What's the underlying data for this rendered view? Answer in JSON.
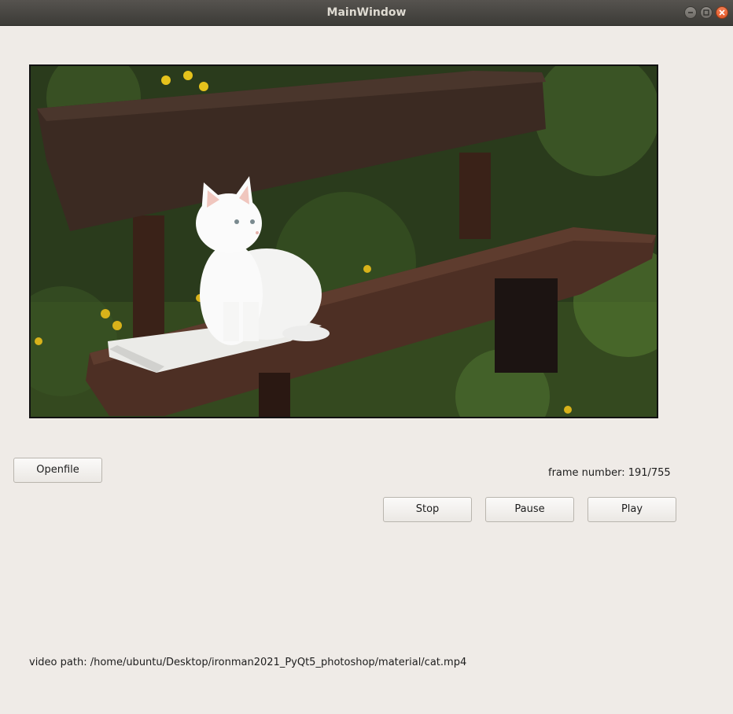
{
  "window": {
    "title": "MainWindow",
    "controls": {
      "minimize_icon": "minimize-icon",
      "maximize_icon": "maximize-icon",
      "close_icon": "close-icon"
    }
  },
  "video": {
    "description_icon": "video-frame-image",
    "frame_number_text": "frame number: 191/755",
    "frame_current": 191,
    "frame_total": 755
  },
  "buttons": {
    "openfile": "Openfile",
    "stop": "Stop",
    "pause": "Pause",
    "play": "Play"
  },
  "path": {
    "text": "video path: /home/ubuntu/Desktop/ironman2021_PyQt5_photoshop/material/cat.mp4"
  },
  "colors": {
    "window_bg": "#efebe7",
    "titlebar": "#3c3b37",
    "close_button": "#e35b2c"
  }
}
